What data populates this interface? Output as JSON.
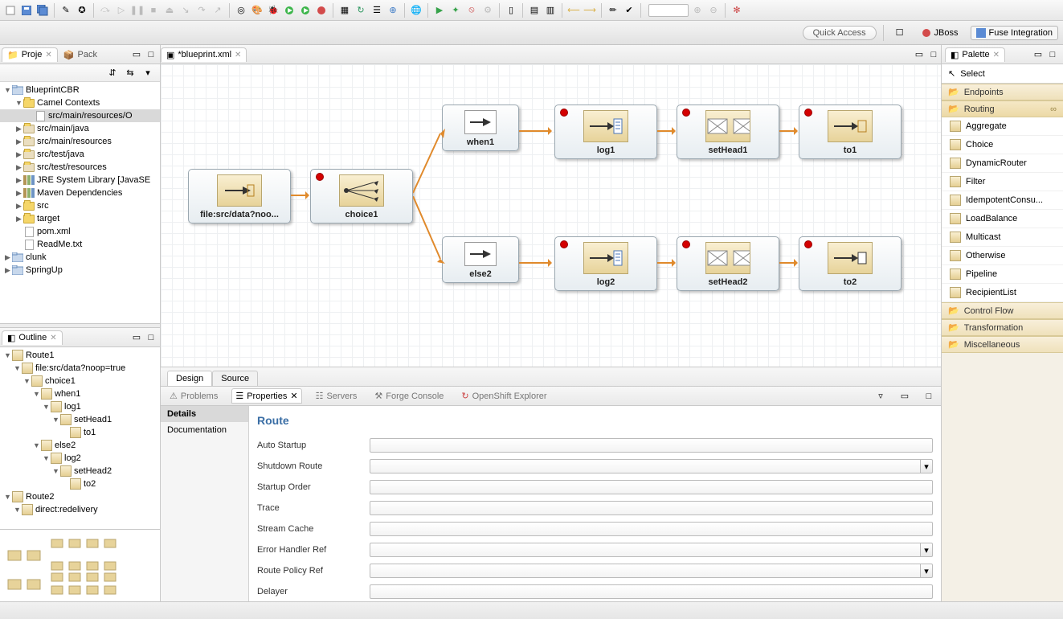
{
  "perspective": {
    "quick_access": "Quick Access",
    "jboss": "JBoss",
    "fuse": "Fuse Integration"
  },
  "left": {
    "tabs": {
      "project": "Proje",
      "package": "Pack"
    },
    "tree": [
      {
        "d": 0,
        "exp": "▼",
        "icon": "proj",
        "label": "BlueprintCBR"
      },
      {
        "d": 1,
        "exp": "▼",
        "icon": "folder",
        "label": "Camel Contexts"
      },
      {
        "d": 2,
        "exp": "",
        "icon": "file",
        "label": "src/main/resources/O",
        "sel": true
      },
      {
        "d": 1,
        "exp": "▶",
        "icon": "pkg",
        "label": "src/main/java"
      },
      {
        "d": 1,
        "exp": "▶",
        "icon": "pkg",
        "label": "src/main/resources"
      },
      {
        "d": 1,
        "exp": "▶",
        "icon": "pkg",
        "label": "src/test/java"
      },
      {
        "d": 1,
        "exp": "▶",
        "icon": "pkg",
        "label": "src/test/resources"
      },
      {
        "d": 1,
        "exp": "▶",
        "icon": "lib",
        "label": "JRE System Library [JavaSE"
      },
      {
        "d": 1,
        "exp": "▶",
        "icon": "lib",
        "label": "Maven Dependencies"
      },
      {
        "d": 1,
        "exp": "▶",
        "icon": "folder",
        "label": "src"
      },
      {
        "d": 1,
        "exp": "▶",
        "icon": "folder",
        "label": "target"
      },
      {
        "d": 1,
        "exp": "",
        "icon": "file",
        "label": "pom.xml"
      },
      {
        "d": 1,
        "exp": "",
        "icon": "file",
        "label": "ReadMe.txt"
      },
      {
        "d": 0,
        "exp": "▶",
        "icon": "proj",
        "label": "clunk"
      },
      {
        "d": 0,
        "exp": "▶",
        "icon": "proj",
        "label": "SpringUp"
      }
    ]
  },
  "outline": {
    "title": "Outline",
    "tree": [
      {
        "d": 0,
        "exp": "▼",
        "label": "Route1"
      },
      {
        "d": 1,
        "exp": "▼",
        "label": "file:src/data?noop=true"
      },
      {
        "d": 2,
        "exp": "▼",
        "label": "choice1"
      },
      {
        "d": 3,
        "exp": "▼",
        "label": "when1"
      },
      {
        "d": 4,
        "exp": "▼",
        "label": "log1"
      },
      {
        "d": 5,
        "exp": "▼",
        "label": "setHead1"
      },
      {
        "d": 6,
        "exp": "",
        "label": "to1"
      },
      {
        "d": 3,
        "exp": "▼",
        "label": "else2"
      },
      {
        "d": 4,
        "exp": "▼",
        "label": "log2"
      },
      {
        "d": 5,
        "exp": "▼",
        "label": "setHead2"
      },
      {
        "d": 6,
        "exp": "",
        "label": "to2"
      },
      {
        "d": 0,
        "exp": "▼",
        "label": "Route2"
      },
      {
        "d": 1,
        "exp": "▼",
        "label": "direct:redelivery"
      }
    ]
  },
  "editor": {
    "tab": "*blueprint.xml",
    "bottom_tabs": {
      "design": "Design",
      "source": "Source"
    },
    "nodes": {
      "file": {
        "label": "file:src/data?noo...",
        "dot": false
      },
      "choice1": {
        "label": "choice1",
        "dot": true
      },
      "when1": {
        "label": "when1",
        "dot": false
      },
      "log1": {
        "label": "log1",
        "dot": true
      },
      "sethead1": {
        "label": "setHead1",
        "dot": true
      },
      "to1": {
        "label": "to1",
        "dot": true
      },
      "else2": {
        "label": "else2",
        "dot": false
      },
      "log2": {
        "label": "log2",
        "dot": true
      },
      "sethead2": {
        "label": "setHead2",
        "dot": true
      },
      "to2": {
        "label": "to2",
        "dot": true
      }
    }
  },
  "bottom": {
    "tabs": [
      "Problems",
      "Properties",
      "Servers",
      "Forge Console",
      "OpenShift Explorer"
    ],
    "active": 1,
    "side": [
      "Details",
      "Documentation"
    ],
    "side_sel": 0,
    "title": "Route",
    "fields": [
      "Auto Startup",
      "Shutdown Route",
      "Startup Order",
      "Trace",
      "Stream Cache",
      "Error Handler Ref",
      "Route Policy Ref",
      "Delayer"
    ]
  },
  "palette": {
    "title": "Palette",
    "select": "Select",
    "drawers": {
      "endpoints": "Endpoints",
      "routing": "Routing",
      "controlflow": "Control Flow",
      "transformation": "Transformation",
      "misc": "Miscellaneous"
    },
    "routing_items": [
      "Aggregate",
      "Choice",
      "DynamicRouter",
      "Filter",
      "IdempotentConsu...",
      "LoadBalance",
      "Multicast",
      "Otherwise",
      "Pipeline",
      "RecipientList"
    ]
  }
}
